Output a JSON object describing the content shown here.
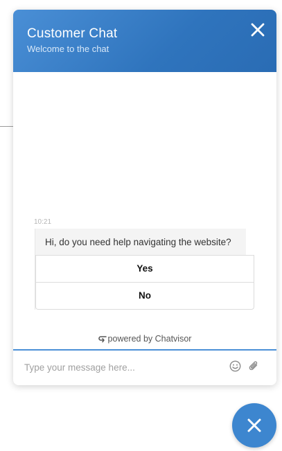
{
  "header": {
    "title": "Customer Chat",
    "subtitle": "Welcome to the chat",
    "close_icon": "close-icon"
  },
  "messages": [
    {
      "time": "10:21",
      "text": "Hi, do you need help navigating the website?",
      "quick_replies": [
        "Yes",
        "No"
      ]
    }
  ],
  "footer": {
    "powered_by": "powered by Chatvisor",
    "powered_icon": "chatvisor-logo-icon"
  },
  "composer": {
    "placeholder": "Type your message here...",
    "value": "",
    "emoji_icon": "emoji-icon",
    "attach_icon": "paperclip-icon"
  },
  "launcher": {
    "icon": "close-icon"
  },
  "colors": {
    "header_start": "#4a8fd6",
    "header_end": "#2a6cb4",
    "accent": "#3d86cf",
    "bubble_bg": "#f4f4f4"
  }
}
